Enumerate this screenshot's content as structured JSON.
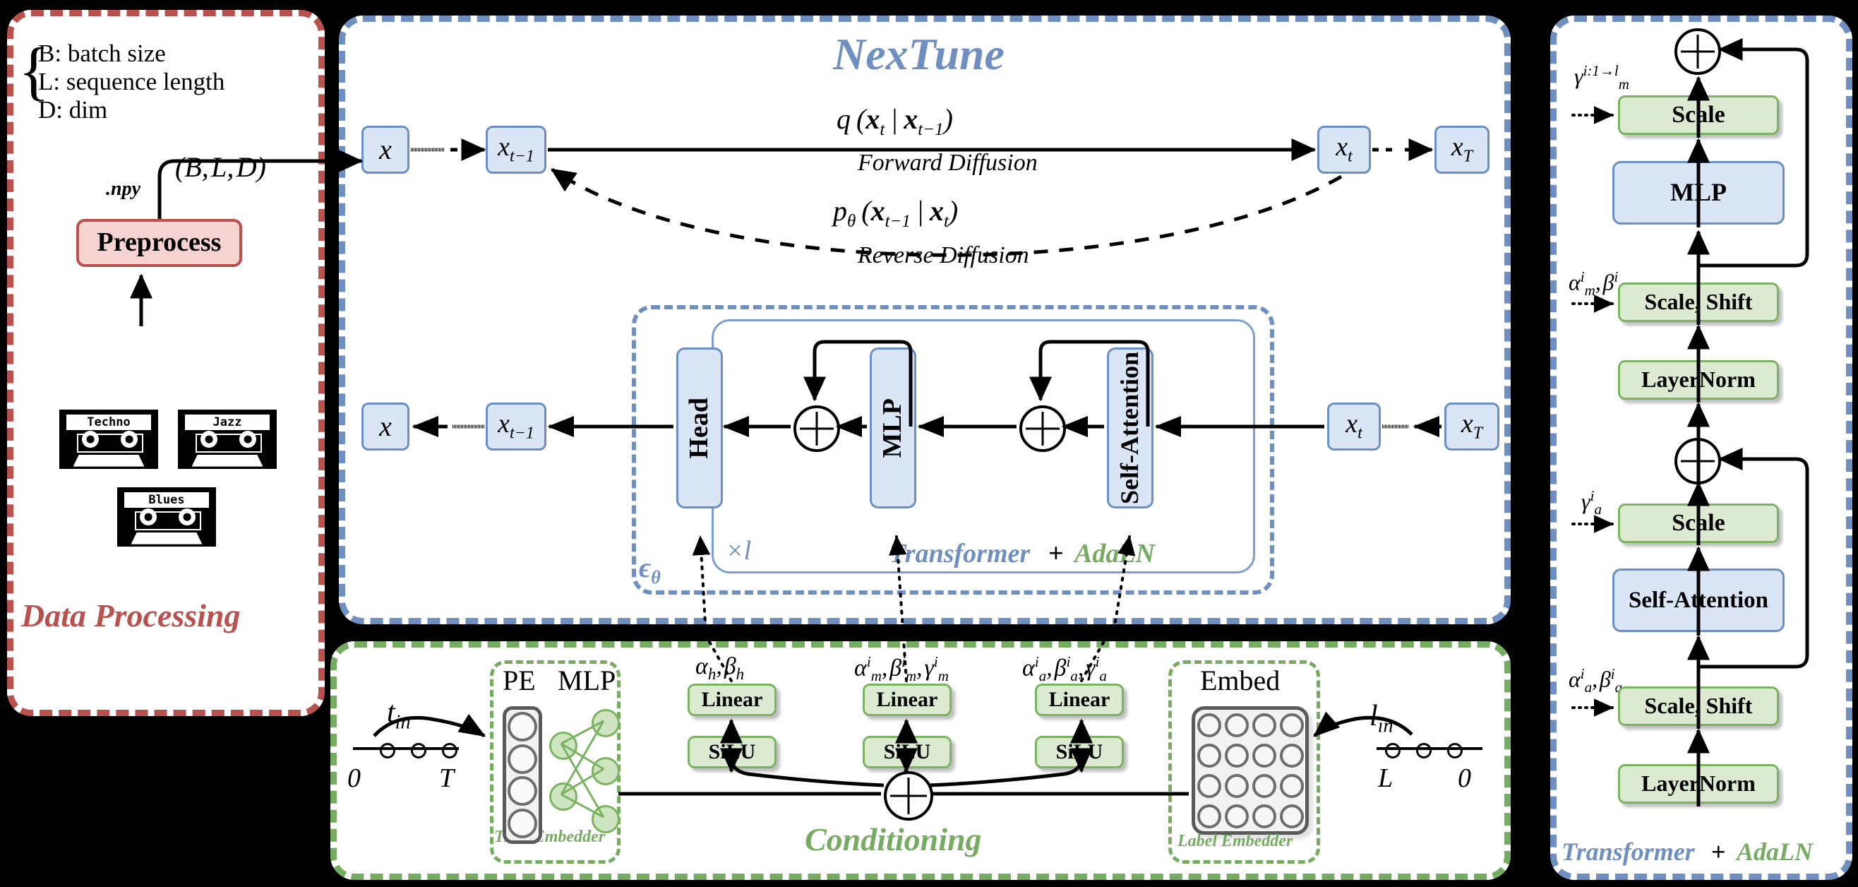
{
  "panels": {
    "data_processing": {
      "caption": "Data Processing",
      "legend": [
        "B: batch size",
        "L: sequence length",
        "D: dim"
      ],
      "shape_label": "(B, L, D)",
      "file_label": ".npy",
      "preprocess_label": "Preprocess",
      "cassettes": [
        "Techno",
        "Jazz",
        "Blues"
      ]
    },
    "nextune": {
      "title": "NexTune",
      "forward": {
        "formula": "q (x_t | x_{t-1})",
        "label": "Forward Diffusion"
      },
      "reverse": {
        "formula": "p_θ (x_{t-1} | x_t)",
        "label": "Reverse Diffusion"
      },
      "top_row": [
        "x",
        "x_{t-1}",
        "x_t",
        "x_T"
      ],
      "bottom_row": [
        "x",
        "x_{t-1}",
        "x_t",
        "x_T"
      ],
      "eps_label": "ϵ_θ",
      "repeat_label": "×l",
      "inner_caption_a": "Transformer",
      "inner_caption_plus": "+",
      "inner_caption_b": "AdaLN",
      "blocks": [
        "Head",
        "MLP",
        "Self-Attention"
      ]
    },
    "conditioning": {
      "caption": "Conditioning",
      "time_embedder": {
        "caption": "Time Embedder",
        "headers": [
          "PE",
          "MLP"
        ],
        "input_label": "t_in",
        "axis_start": "0",
        "axis_end": "T"
      },
      "label_embedder": {
        "caption": "Label Embedder",
        "header": "Embed",
        "input_label": "l_in",
        "axis_start": "L",
        "axis_end": "0"
      },
      "branches": [
        {
          "params": "α_h, β_h",
          "top": "Linear",
          "bottom": "SiLU"
        },
        {
          "params": "α^i_m, β^i_m, γ^i_m",
          "top": "Linear",
          "bottom": "SiLU"
        },
        {
          "params": "α^i_a, β^i_a, γ^i_a",
          "top": "Linear",
          "bottom": "SiLU"
        }
      ]
    },
    "adaln_detail": {
      "caption_a": "Transformer",
      "caption_plus": "+",
      "caption_b": "AdaLN",
      "stack": [
        {
          "name": "LayerNorm",
          "kind": "green",
          "param": ""
        },
        {
          "name": "Scale, Shift",
          "kind": "green",
          "param": "α^i_a, β^i_a"
        },
        {
          "name": "Self-Attention",
          "kind": "blue",
          "param": ""
        },
        {
          "name": "Scale",
          "kind": "green",
          "param": "γ^i_a"
        },
        {
          "name": "LayerNorm",
          "kind": "green",
          "param": ""
        },
        {
          "name": "Scale, Shift",
          "kind": "green",
          "param": "α^i_m, β^i_m"
        },
        {
          "name": "MLP",
          "kind": "blue",
          "param": ""
        },
        {
          "name": "Scale",
          "kind": "green",
          "param": "γ^{i:1→l}_m"
        }
      ]
    }
  },
  "colors": {
    "red": "#b9514e",
    "blue": "#6f8fc0",
    "green": "#76ab62",
    "box_blue_fill": "#dae5f5",
    "box_blue_border": "#6a8fc4",
    "box_green_fill": "#dbead0",
    "box_green_border": "#7cb362",
    "box_red_fill": "#f6d2d0"
  }
}
